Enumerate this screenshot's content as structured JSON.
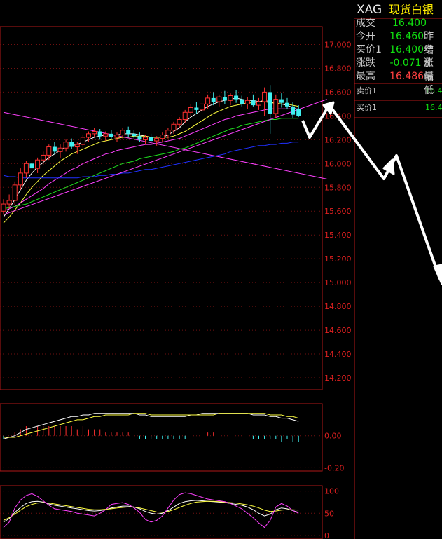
{
  "header": {
    "code": "XAG",
    "name": "现货白银"
  },
  "quote": [
    {
      "label": "成交",
      "value": "16.400",
      "color": "#10e010",
      "extra": ""
    },
    {
      "label": "今开",
      "value": "16.460",
      "color": "#10e010",
      "extra": "昨结"
    },
    {
      "label": "买价1",
      "value": "16.400",
      "color": "#10e010",
      "extra": "卖价"
    },
    {
      "label": "涨跌",
      "value": "-0.071",
      "color": "#10e010",
      "extra": "涨幅"
    },
    {
      "label": "最高",
      "value": "16.486",
      "color": "#ff4040",
      "extra": "最低"
    }
  ],
  "order_book": {
    "ask_label": "卖价1",
    "ask_value": "16.4",
    "bid_label": "买价1",
    "bid_value": "16.4"
  },
  "colors": {
    "up": "#ff3030",
    "down": "#40f0f0",
    "axis": "#c01818",
    "ma_white": "#ffffff",
    "ma_yellow": "#ffff40",
    "ma_magenta": "#ff40ff",
    "ma_green": "#20e020",
    "ma_blue": "#2030ff",
    "trend_magenta": "#ff40ff"
  },
  "chart_data": [
    {
      "type": "candlestick",
      "name": "price",
      "ylim": [
        14.1,
        17.15
      ],
      "yticks": [
        "17.000",
        "16.800",
        "16.600",
        "16.400",
        "16.200",
        "16.000",
        "15.800",
        "15.600",
        "15.400",
        "15.200",
        "15.000",
        "14.800",
        "14.600",
        "14.400",
        "14.200"
      ],
      "candles": [
        [
          15.6,
          15.7,
          15.57,
          15.66
        ],
        [
          15.66,
          15.74,
          15.62,
          15.69
        ],
        [
          15.69,
          15.85,
          15.65,
          15.82
        ],
        [
          15.82,
          15.96,
          15.78,
          15.92
        ],
        [
          15.92,
          16.02,
          15.88,
          16.0
        ],
        [
          16.0,
          16.06,
          15.93,
          15.96
        ],
        [
          15.96,
          16.05,
          15.92,
          16.03
        ],
        [
          16.03,
          16.1,
          15.99,
          16.07
        ],
        [
          16.07,
          16.16,
          16.03,
          16.14
        ],
        [
          16.14,
          16.18,
          16.08,
          16.1
        ],
        [
          16.1,
          16.16,
          16.05,
          16.13
        ],
        [
          16.13,
          16.2,
          16.1,
          16.18
        ],
        [
          16.18,
          16.21,
          16.12,
          16.14
        ],
        [
          16.14,
          16.18,
          16.08,
          16.16
        ],
        [
          16.16,
          16.24,
          16.12,
          16.22
        ],
        [
          16.22,
          16.27,
          16.18,
          16.25
        ],
        [
          16.25,
          16.3,
          16.22,
          16.27
        ],
        [
          16.27,
          16.29,
          16.2,
          16.23
        ],
        [
          16.23,
          16.27,
          16.19,
          16.25
        ],
        [
          16.25,
          16.28,
          16.2,
          16.22
        ],
        [
          16.22,
          16.26,
          16.18,
          16.24
        ],
        [
          16.24,
          16.3,
          16.21,
          16.28
        ],
        [
          16.28,
          16.31,
          16.22,
          16.25
        ],
        [
          16.25,
          16.28,
          16.21,
          16.23
        ],
        [
          16.23,
          16.26,
          16.18,
          16.2
        ],
        [
          16.2,
          16.24,
          16.16,
          16.22
        ],
        [
          16.22,
          16.25,
          16.18,
          16.19
        ],
        [
          16.19,
          16.23,
          16.15,
          16.21
        ],
        [
          16.21,
          16.26,
          16.18,
          16.24
        ],
        [
          16.24,
          16.3,
          16.21,
          16.28
        ],
        [
          16.28,
          16.35,
          16.25,
          16.33
        ],
        [
          16.33,
          16.39,
          16.3,
          16.37
        ],
        [
          16.37,
          16.45,
          16.34,
          16.43
        ],
        [
          16.43,
          16.5,
          16.4,
          16.47
        ],
        [
          16.47,
          16.52,
          16.42,
          16.45
        ],
        [
          16.45,
          16.52,
          16.42,
          16.5
        ],
        [
          16.5,
          16.58,
          16.46,
          16.55
        ],
        [
          16.55,
          16.6,
          16.49,
          16.52
        ],
        [
          16.52,
          16.58,
          16.48,
          16.56
        ],
        [
          16.56,
          16.61,
          16.5,
          16.53
        ],
        [
          16.53,
          16.59,
          16.49,
          16.57
        ],
        [
          16.57,
          16.62,
          16.51,
          16.54
        ],
        [
          16.54,
          16.57,
          16.48,
          16.5
        ],
        [
          16.5,
          16.56,
          16.46,
          16.53
        ],
        [
          16.53,
          16.58,
          16.48,
          16.49
        ],
        [
          16.49,
          16.55,
          16.45,
          16.52
        ],
        [
          16.52,
          16.64,
          16.4,
          16.6
        ],
        [
          16.6,
          16.66,
          16.25,
          16.42
        ],
        [
          16.42,
          16.58,
          16.38,
          16.54
        ],
        [
          16.54,
          16.59,
          16.47,
          16.51
        ],
        [
          16.51,
          16.55,
          16.46,
          16.48
        ],
        [
          16.48,
          16.52,
          16.38,
          16.41
        ],
        [
          16.46,
          16.49,
          16.39,
          16.4
        ]
      ],
      "moving_averages": [
        {
          "color": "white",
          "values": [
            15.55,
            15.62,
            15.7,
            15.78,
            15.86,
            15.92,
            15.97,
            16.01,
            16.05,
            16.08,
            16.11,
            16.14,
            16.15,
            16.16,
            16.18,
            16.2,
            16.22,
            16.23,
            16.24,
            16.24,
            16.24,
            16.25,
            16.25,
            16.25,
            16.24,
            16.23,
            16.22,
            16.22,
            16.22,
            16.24,
            16.27,
            16.3,
            16.35,
            16.39,
            16.42,
            16.45,
            16.48,
            16.5,
            16.52,
            16.53,
            16.54,
            16.55,
            16.54,
            16.53,
            16.53,
            16.52,
            16.53,
            16.52,
            16.5,
            16.5,
            16.49,
            16.47,
            16.45
          ]
        },
        {
          "color": "yellow",
          "values": [
            15.5,
            15.55,
            15.61,
            15.67,
            15.74,
            15.8,
            15.85,
            15.9,
            15.94,
            15.98,
            16.02,
            16.05,
            16.08,
            16.1,
            16.12,
            16.14,
            16.16,
            16.18,
            16.19,
            16.2,
            16.21,
            16.22,
            16.22,
            16.23,
            16.23,
            16.23,
            16.22,
            16.22,
            16.22,
            16.22,
            16.23,
            16.25,
            16.27,
            16.3,
            16.33,
            16.36,
            16.39,
            16.42,
            16.44,
            16.46,
            16.48,
            16.49,
            16.5,
            16.51,
            16.51,
            16.52,
            16.52,
            16.51,
            16.51,
            16.5,
            16.5,
            16.49,
            16.48
          ]
        },
        {
          "color": "magenta",
          "values": [
            15.6,
            15.62,
            15.64,
            15.67,
            15.7,
            15.73,
            15.76,
            15.79,
            15.83,
            15.86,
            15.89,
            15.92,
            15.95,
            15.97,
            16.0,
            16.02,
            16.04,
            16.06,
            16.08,
            16.09,
            16.11,
            16.12,
            16.13,
            16.14,
            16.15,
            16.16,
            16.16,
            16.17,
            16.18,
            16.19,
            16.2,
            16.21,
            16.23,
            16.25,
            16.27,
            16.29,
            16.31,
            16.33,
            16.35,
            16.37,
            16.38,
            16.4,
            16.41,
            16.42,
            16.43,
            16.44,
            16.45,
            16.46,
            16.46,
            16.46,
            16.46,
            16.46,
            16.46
          ]
        },
        {
          "color": "green",
          "values": [
            15.62,
            15.63,
            15.64,
            15.65,
            15.66,
            15.68,
            15.7,
            15.72,
            15.74,
            15.76,
            15.78,
            15.8,
            15.82,
            15.84,
            15.86,
            15.88,
            15.9,
            15.92,
            15.94,
            15.96,
            15.98,
            16.0,
            16.01,
            16.02,
            16.04,
            16.05,
            16.06,
            16.07,
            16.08,
            16.09,
            16.1,
            16.12,
            16.13,
            16.15,
            16.17,
            16.19,
            16.21,
            16.23,
            16.25,
            16.27,
            16.29,
            16.3,
            16.32,
            16.33,
            16.34,
            16.35,
            16.36,
            16.37,
            16.37,
            16.38,
            16.38,
            16.38,
            16.38
          ]
        },
        {
          "color": "blue",
          "values": [
            15.9,
            15.89,
            15.89,
            15.88,
            15.88,
            15.88,
            15.88,
            15.88,
            15.88,
            15.88,
            15.88,
            15.88,
            15.88,
            15.88,
            15.89,
            15.89,
            15.89,
            15.9,
            15.9,
            15.91,
            15.91,
            15.92,
            15.92,
            15.93,
            15.94,
            15.95,
            15.95,
            15.96,
            15.97,
            15.98,
            15.99,
            16.0,
            16.01,
            16.02,
            16.03,
            16.04,
            16.05,
            16.06,
            16.07,
            16.08,
            16.1,
            16.11,
            16.12,
            16.13,
            16.14,
            16.15,
            16.15,
            16.16,
            16.16,
            16.17,
            16.17,
            16.18,
            16.18
          ]
        }
      ],
      "trendlines": [
        {
          "from": [
            0,
            16.43
          ],
          "to": [
            57,
            15.87
          ]
        },
        {
          "from": [
            0,
            15.57
          ],
          "to": [
            57,
            16.54
          ]
        }
      ]
    },
    {
      "type": "bar",
      "name": "macd",
      "ylim": [
        -0.22,
        0.2
      ],
      "yticks": [
        "0.00",
        "-0.20"
      ],
      "dif": [
        -0.02,
        -0.01,
        0.0,
        0.02,
        0.04,
        0.05,
        0.06,
        0.07,
        0.08,
        0.09,
        0.1,
        0.11,
        0.12,
        0.12,
        0.13,
        0.13,
        0.14,
        0.14,
        0.14,
        0.14,
        0.14,
        0.14,
        0.14,
        0.14,
        0.13,
        0.13,
        0.12,
        0.12,
        0.12,
        0.12,
        0.12,
        0.12,
        0.12,
        0.13,
        0.13,
        0.14,
        0.14,
        0.14,
        0.14,
        0.14,
        0.14,
        0.14,
        0.14,
        0.14,
        0.13,
        0.13,
        0.13,
        0.12,
        0.12,
        0.11,
        0.11,
        0.1,
        0.09
      ],
      "dea": [
        -0.01,
        -0.01,
        -0.01,
        0.0,
        0.01,
        0.02,
        0.03,
        0.04,
        0.05,
        0.06,
        0.07,
        0.08,
        0.09,
        0.1,
        0.1,
        0.11,
        0.12,
        0.12,
        0.13,
        0.13,
        0.13,
        0.13,
        0.13,
        0.14,
        0.14,
        0.14,
        0.13,
        0.13,
        0.13,
        0.13,
        0.13,
        0.13,
        0.13,
        0.13,
        0.13,
        0.13,
        0.13,
        0.13,
        0.14,
        0.14,
        0.14,
        0.14,
        0.14,
        0.14,
        0.14,
        0.14,
        0.14,
        0.13,
        0.13,
        0.13,
        0.12,
        0.12,
        0.11
      ],
      "hist": [
        -0.02,
        0.0,
        0.02,
        0.04,
        0.06,
        0.06,
        0.06,
        0.06,
        0.06,
        0.06,
        0.06,
        0.06,
        0.06,
        0.04,
        0.06,
        0.04,
        0.04,
        0.04,
        0.02,
        0.02,
        0.02,
        0.02,
        0.02,
        0.0,
        -0.02,
        -0.02,
        -0.02,
        -0.02,
        -0.02,
        -0.02,
        -0.02,
        -0.02,
        -0.02,
        0.0,
        0.0,
        0.02,
        0.02,
        0.02,
        0.0,
        0.0,
        0.0,
        0.0,
        0.0,
        0.0,
        -0.02,
        -0.02,
        -0.02,
        -0.02,
        -0.02,
        -0.04,
        -0.02,
        -0.04,
        -0.04
      ]
    },
    {
      "type": "line",
      "name": "kdj",
      "ylim": [
        -8,
        112
      ],
      "yticks": [
        "100",
        "50",
        "0"
      ],
      "series": [
        {
          "color": "white",
          "values": [
            30,
            38,
            52,
            63,
            72,
            76,
            77,
            75,
            71,
            68,
            66,
            64,
            62,
            60,
            58,
            56,
            55,
            56,
            58,
            62,
            64,
            66,
            66,
            64,
            60,
            54,
            50,
            48,
            50,
            56,
            64,
            72,
            76,
            78,
            79,
            78,
            77,
            76,
            75,
            74,
            72,
            70,
            68,
            64,
            58,
            50,
            44,
            48,
            58,
            62,
            60,
            56,
            52
          ]
        },
        {
          "color": "yellow",
          "values": [
            34,
            40,
            48,
            57,
            65,
            70,
            73,
            74,
            73,
            71,
            69,
            67,
            65,
            63,
            61,
            59,
            58,
            58,
            59,
            60,
            62,
            63,
            64,
            64,
            62,
            59,
            56,
            53,
            52,
            54,
            58,
            63,
            68,
            72,
            75,
            76,
            77,
            77,
            76,
            75,
            74,
            73,
            71,
            69,
            66,
            62,
            57,
            54,
            55,
            57,
            58,
            58,
            57
          ]
        },
        {
          "color": "magenta",
          "values": [
            18,
            30,
            62,
            80,
            90,
            94,
            88,
            78,
            68,
            60,
            58,
            56,
            54,
            50,
            48,
            46,
            44,
            50,
            58,
            70,
            72,
            74,
            70,
            62,
            52,
            36,
            30,
            34,
            44,
            62,
            80,
            92,
            96,
            94,
            90,
            86,
            82,
            80,
            78,
            76,
            72,
            66,
            60,
            50,
            40,
            28,
            18,
            34,
            64,
            72,
            66,
            56,
            50
          ]
        }
      ]
    }
  ]
}
